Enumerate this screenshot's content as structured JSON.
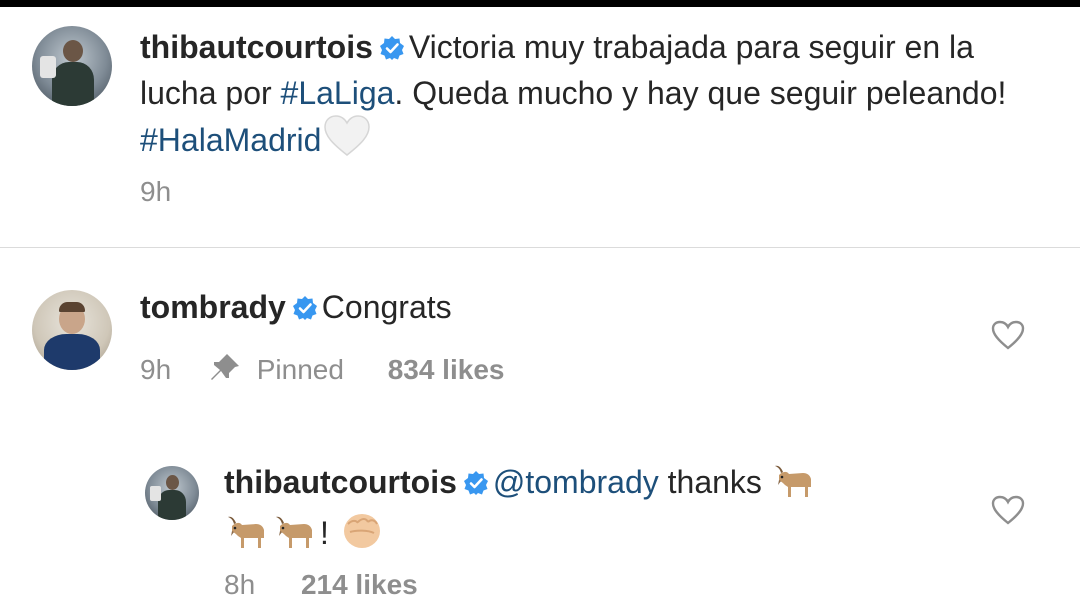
{
  "caption": {
    "username": "thibautcourtois",
    "text_part1": "Victoria muy trabajada para seguir en la lucha por ",
    "hashtag1": "#LaLiga",
    "text_part2": ". Queda mucho y hay que seguir peleando! ",
    "hashtag2": "#HalaMadrid",
    "emoji": "white-heart",
    "time": "9h"
  },
  "comment": {
    "username": "tombrady",
    "text": "Congrats",
    "time": "9h",
    "pinned_label": "Pinned",
    "likes": "834 likes"
  },
  "reply": {
    "username": "thibautcourtois",
    "mention": "@tombrady",
    "text": " thanks",
    "after_goats": "!",
    "emojis": [
      "goat",
      "goat",
      "goat",
      "oncoming-fist"
    ],
    "time": "8h",
    "likes": "214 likes"
  },
  "colors": {
    "link": "#1d4f7a",
    "verified": "#3897f0",
    "meta": "#8e8e8e",
    "text": "#262626"
  }
}
